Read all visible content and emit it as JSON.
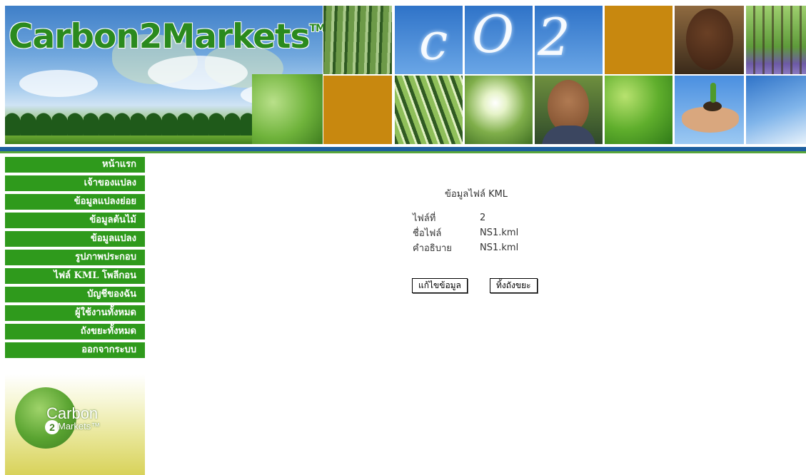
{
  "header": {
    "brand": "Carbon2Markets",
    "brand_tm": "TM",
    "co2_letters": [
      "c",
      "O",
      "2"
    ]
  },
  "sidebar": {
    "items": [
      {
        "label": "หน้าแรก"
      },
      {
        "label": "เจ้าของแปลง"
      },
      {
        "label": "ข้อมูลแปลงย่อย"
      },
      {
        "label": "ข้อมูลต้นไม้"
      },
      {
        "label": "ข้อมูลแปลง"
      },
      {
        "label": "รูปภาพประกอบ"
      },
      {
        "label": "ไฟล์ KML โพลีกอน"
      },
      {
        "label": "บัญชีของฉัน"
      },
      {
        "label": "ผู้ใช้งานทั้งหมด"
      },
      {
        "label": "ถังขยะทั้งหมด"
      },
      {
        "label": "ออกจากระบบ"
      }
    ],
    "logo": {
      "line1": "arbon",
      "line2": "Markets",
      "tm": "™",
      "c_letter": "C",
      "digit": "2"
    }
  },
  "main": {
    "title": "ข้อมูลไฟล์ KML",
    "rows": [
      {
        "label": "ไฟล์ที่",
        "value": "2"
      },
      {
        "label": "ชื่อไฟล์",
        "value": "NS1.kml"
      },
      {
        "label": "คำอธิบาย",
        "value": "NS1.kml"
      }
    ],
    "buttons": {
      "edit": "แก้ไขข้อมูล",
      "trash": "ทิ้งถังขยะ"
    }
  },
  "colors": {
    "nav_green": "#2f9a1c",
    "brand_green": "#2b8a1e",
    "rule_blue": "#1d5f9e",
    "rule_green": "#58a63c"
  }
}
